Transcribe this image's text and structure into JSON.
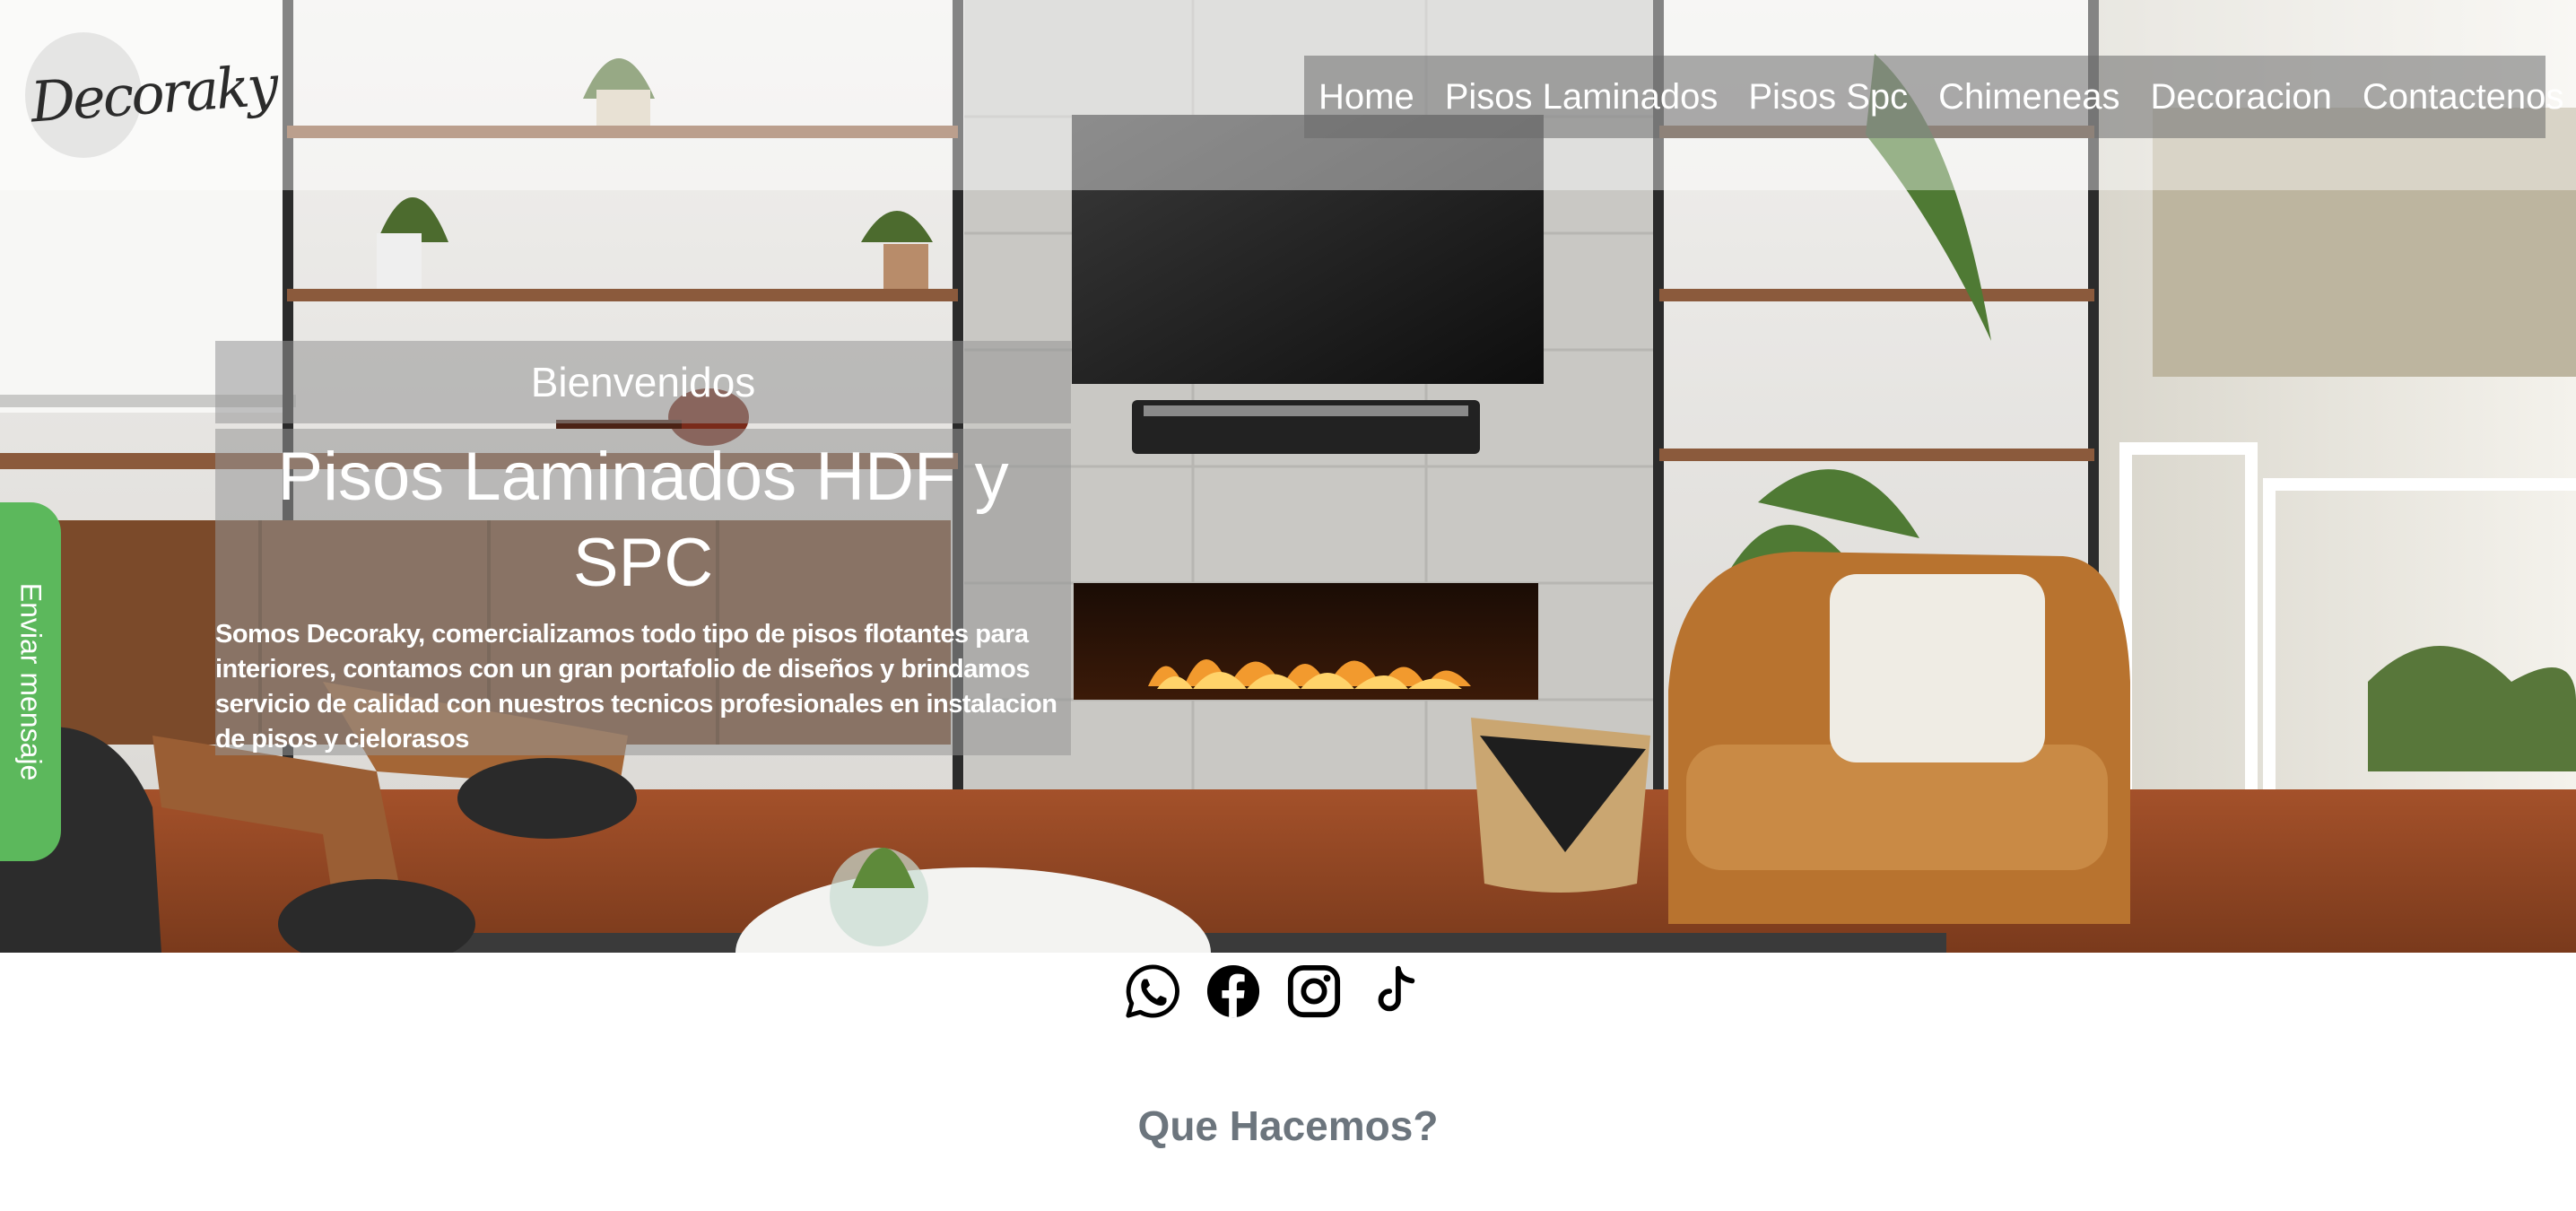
{
  "brand": {
    "logo_text": "Decoraky"
  },
  "nav": {
    "items": [
      {
        "label": "Home"
      },
      {
        "label": "Pisos Laminados"
      },
      {
        "label": "Pisos Spc"
      },
      {
        "label": "Chimeneas"
      },
      {
        "label": "Decoracion"
      },
      {
        "label": "Contactenos"
      }
    ]
  },
  "hero": {
    "welcome": "Bienvenidos",
    "title": "Pisos Laminados HDF y SPC",
    "description": "Somos Decoraky, comercializamos todo tipo de pisos flotantes para interiores, contamos con un gran portafolio de diseños y brindamos servicio de calidad con nuestros tecnicos profesionales en instalacion de pisos y cielorasos"
  },
  "side_tab": {
    "label": "Enviar mensaje",
    "color": "#5cb85c"
  },
  "social": [
    {
      "icon": "whatsapp-icon"
    },
    {
      "icon": "facebook-icon"
    },
    {
      "icon": "instagram-icon"
    },
    {
      "icon": "tiktok-icon"
    }
  ],
  "section": {
    "heading": "Que Hacemos?"
  },
  "colors": {
    "heading_gray": "#6c757d",
    "nav_overlay": "#696969"
  }
}
